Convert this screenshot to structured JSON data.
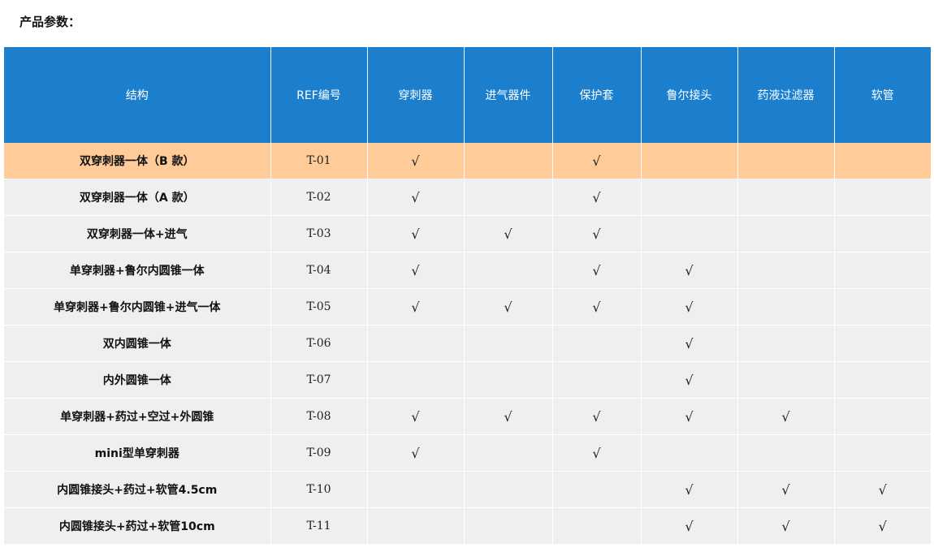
{
  "heading": "产品参数：",
  "columns": [
    "结构",
    "REF编号",
    "穿刺器",
    "进气器件",
    "保护套",
    "鲁尔接头",
    "药液过滤器",
    "软管"
  ],
  "check_symbol": "√",
  "highlight_color": "#ffcc99",
  "header_color": "#1c7fce",
  "rows": [
    {
      "structure": "双穿刺器一体（B 款）",
      "ref": "T-01",
      "marks": [
        "√",
        "",
        "√",
        "",
        "",
        ""
      ]
    },
    {
      "structure": "双穿刺器一体（A 款）",
      "ref": "T-02",
      "marks": [
        "√",
        "",
        "√",
        "",
        "",
        ""
      ]
    },
    {
      "structure": "双穿刺器一体+进气",
      "ref": "T-03",
      "marks": [
        "√",
        "√",
        "√",
        "",
        "",
        ""
      ]
    },
    {
      "structure": "单穿刺器+鲁尔内圆锥一体",
      "ref": "T-04",
      "marks": [
        "√",
        "",
        "√",
        "√",
        "",
        ""
      ]
    },
    {
      "structure": "单穿刺器+鲁尔内圆锥+进气一体",
      "ref": "T-05",
      "marks": [
        "√",
        "√",
        "√",
        "√",
        "",
        ""
      ]
    },
    {
      "structure": "双内圆锥一体",
      "ref": "T-06",
      "marks": [
        "",
        "",
        "",
        "√",
        "",
        ""
      ]
    },
    {
      "structure": "内外圆锥一体",
      "ref": "T-07",
      "marks": [
        "",
        "",
        "",
        "√",
        "",
        ""
      ]
    },
    {
      "structure": "单穿刺器+药过+空过+外圆锥",
      "ref": "T-08",
      "marks": [
        "√",
        "√",
        "√",
        "√",
        "√",
        ""
      ]
    },
    {
      "structure": "mini型单穿刺器",
      "ref": "T-09",
      "marks": [
        "√",
        "",
        "√",
        "",
        "",
        ""
      ]
    },
    {
      "structure": "内圆锥接头+药过+软管4.5cm",
      "ref": "T-10",
      "marks": [
        "",
        "",
        "",
        "√",
        "√",
        "√"
      ]
    },
    {
      "structure": "内圆锥接头+药过+软管10cm",
      "ref": "T-11",
      "marks": [
        "",
        "",
        "",
        "√",
        "√",
        "√"
      ]
    }
  ]
}
